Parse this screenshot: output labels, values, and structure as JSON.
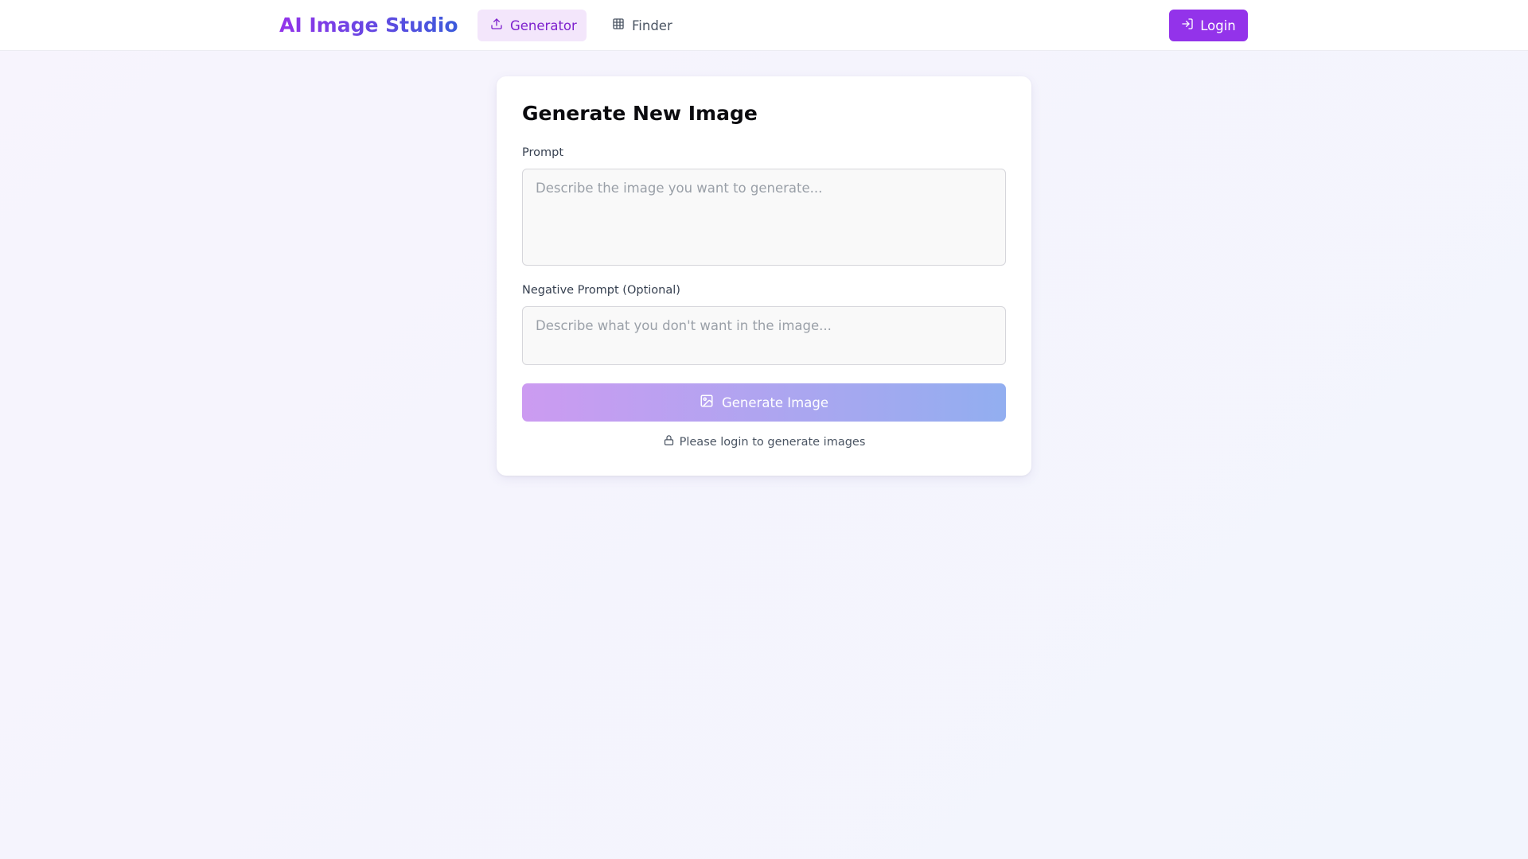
{
  "app": {
    "title": "AI Image Studio",
    "accent_color": "#9333ea",
    "brand_gradient": [
      "#9333ea",
      "#3b5bdb"
    ]
  },
  "nav": {
    "items": [
      {
        "label": "Generator",
        "icon": "upload-icon",
        "active": true
      },
      {
        "label": "Finder",
        "icon": "grid-icon",
        "active": false
      }
    ],
    "login_label": "Login",
    "login_icon": "login-icon"
  },
  "card": {
    "title": "Generate New Image",
    "prompt": {
      "label": "Prompt",
      "value": "",
      "placeholder": "Describe the image you want to generate..."
    },
    "negative_prompt": {
      "label": "Negative Prompt (Optional)",
      "value": "",
      "placeholder": "Describe what you don't want in the image..."
    },
    "generate_button": {
      "label": "Generate Image",
      "icon": "image-icon",
      "disabled": true,
      "gradient": [
        "#cc9bf1",
        "#92aef0"
      ]
    },
    "login_note": {
      "text": "Please login to generate images",
      "icon": "lock-icon"
    }
  }
}
